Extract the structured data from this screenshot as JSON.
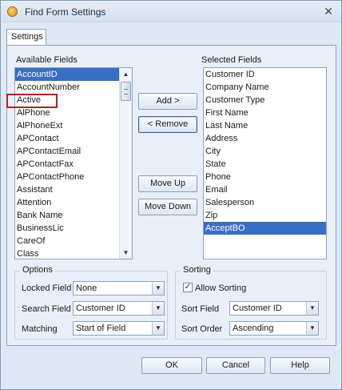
{
  "window": {
    "title": "Find Form Settings",
    "close_glyph": "✕",
    "app_icon": "app-icon"
  },
  "tabs": [
    {
      "label": "Settings"
    }
  ],
  "available": {
    "label": "Available Fields",
    "items": [
      "AccountID",
      "AccountNumber",
      "Active",
      "AlPhone",
      "AlPhoneExt",
      "APContact",
      "APContactEmail",
      "APContactFax",
      "APContactPhone",
      "Assistant",
      "Attention",
      "Bank Name",
      "BusinessLic",
      "CareOf",
      "Class"
    ],
    "selected_index": 0,
    "highlighted_item": "Active"
  },
  "selected": {
    "label": "Selected Fields",
    "items": [
      "Customer ID",
      "Company Name",
      "Customer Type",
      "First Name",
      "Last Name",
      "Address",
      "City",
      "State",
      "Phone",
      "Email",
      "Salesperson",
      "Zip",
      "AcceptBO"
    ],
    "selected_index": 12
  },
  "buttons": {
    "add": "Add >",
    "remove": "< Remove",
    "move_up": "Move Up",
    "move_down": "Move Down",
    "ok": "OK",
    "cancel": "Cancel",
    "help": "Help"
  },
  "options": {
    "title": "Options",
    "locked_label": "Locked Field",
    "locked_value": "None",
    "search_label": "Search Field",
    "search_value": "Customer ID",
    "matching_label": "Matching",
    "matching_value": "Start of Field"
  },
  "sorting": {
    "title": "Sorting",
    "allow_label": "Allow Sorting",
    "allow_checked": true,
    "check_glyph": "✓",
    "sort_field_label": "Sort Field",
    "sort_field_value": "Customer ID",
    "sort_order_label": "Sort Order",
    "sort_order_value": "Ascending"
  },
  "glyphs": {
    "up": "▲",
    "down": "▼"
  },
  "colors": {
    "selection": "#3a6ec2",
    "highlight_border": "#b62025",
    "window_bg": "#dfe8f5"
  }
}
